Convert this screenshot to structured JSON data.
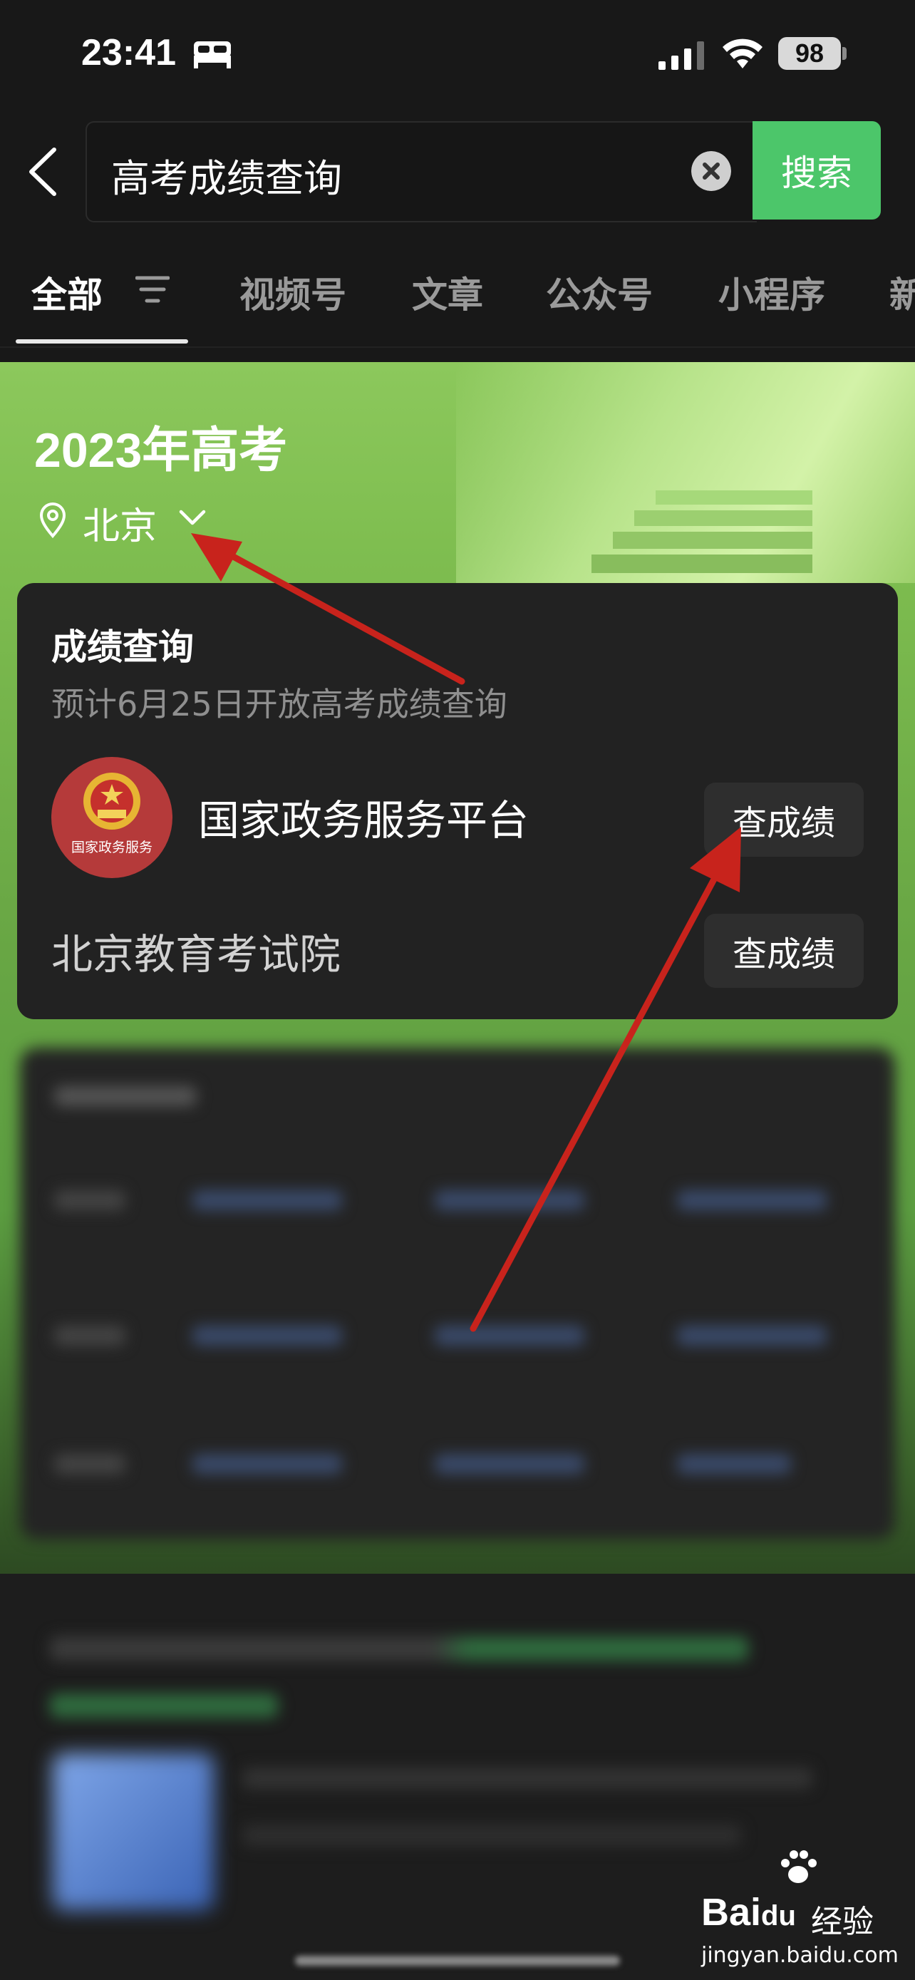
{
  "status_bar": {
    "time": "23:41",
    "battery": "98"
  },
  "search": {
    "query": "高考成绩查询",
    "button": "搜索"
  },
  "tabs": [
    "全部",
    "视频号",
    "文章",
    "公众号",
    "小程序",
    "新"
  ],
  "hero": {
    "title": "2023年高考",
    "region": "北京"
  },
  "card": {
    "title": "成绩查询",
    "subtitle": "预计6月25日开放高考成绩查询",
    "providers": [
      {
        "name": "国家政务服务平台",
        "logo_text": "国家政务服务",
        "button": "查成绩"
      },
      {
        "name": "北京教育考试院",
        "button": "查成绩"
      }
    ]
  },
  "watermark": {
    "brand_left": "Bai",
    "brand_mid": "du",
    "brand_right": "经验",
    "url": "jingyan.baidu.com"
  },
  "colors": {
    "accent_green": "#4cc66a",
    "annotation_red": "#c8231c",
    "logo_red": "#b53a3a"
  }
}
